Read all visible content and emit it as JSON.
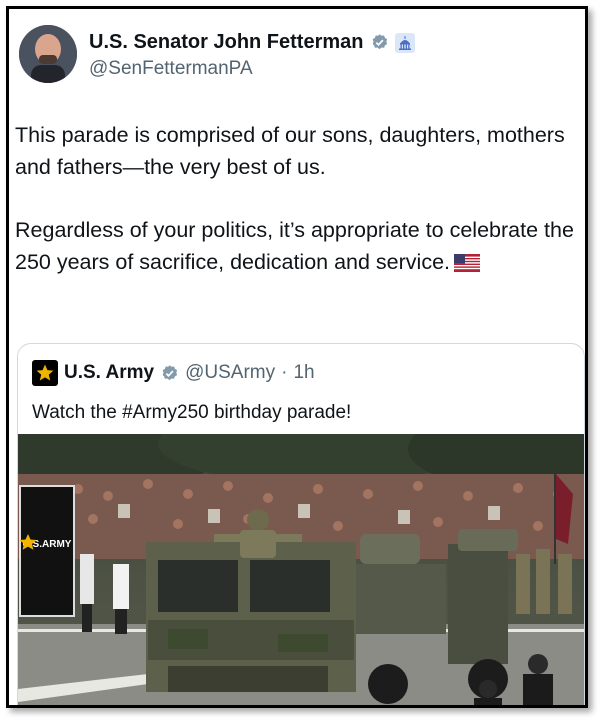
{
  "tweet": {
    "author_name": "U.S. Senator John Fetterman",
    "author_handle": "@SenFettermanPA",
    "paragraph_1": "This parade is comprised of our sons, daughters, mothers and fathers—the very best of us.",
    "paragraph_2": "Regardless of your politics, it’s appropriate to celebrate the 250 years of sacrifice, dedication and service.",
    "icons": [
      "verified-badge-icon",
      "capitol-building-icon",
      "us-flag-icon"
    ]
  },
  "quoted_tweet": {
    "author_name": "U.S. Army",
    "author_handle": "@USArmy",
    "separator": "·",
    "time_ago": "1h",
    "text": "Watch the #Army250 birthday parade!",
    "media_banner_text": "U.S.ARMY"
  },
  "colors": {
    "text_primary": "#0f1419",
    "text_secondary": "#536471",
    "border": "#cfd9de",
    "army_gold": "#f0b400"
  }
}
